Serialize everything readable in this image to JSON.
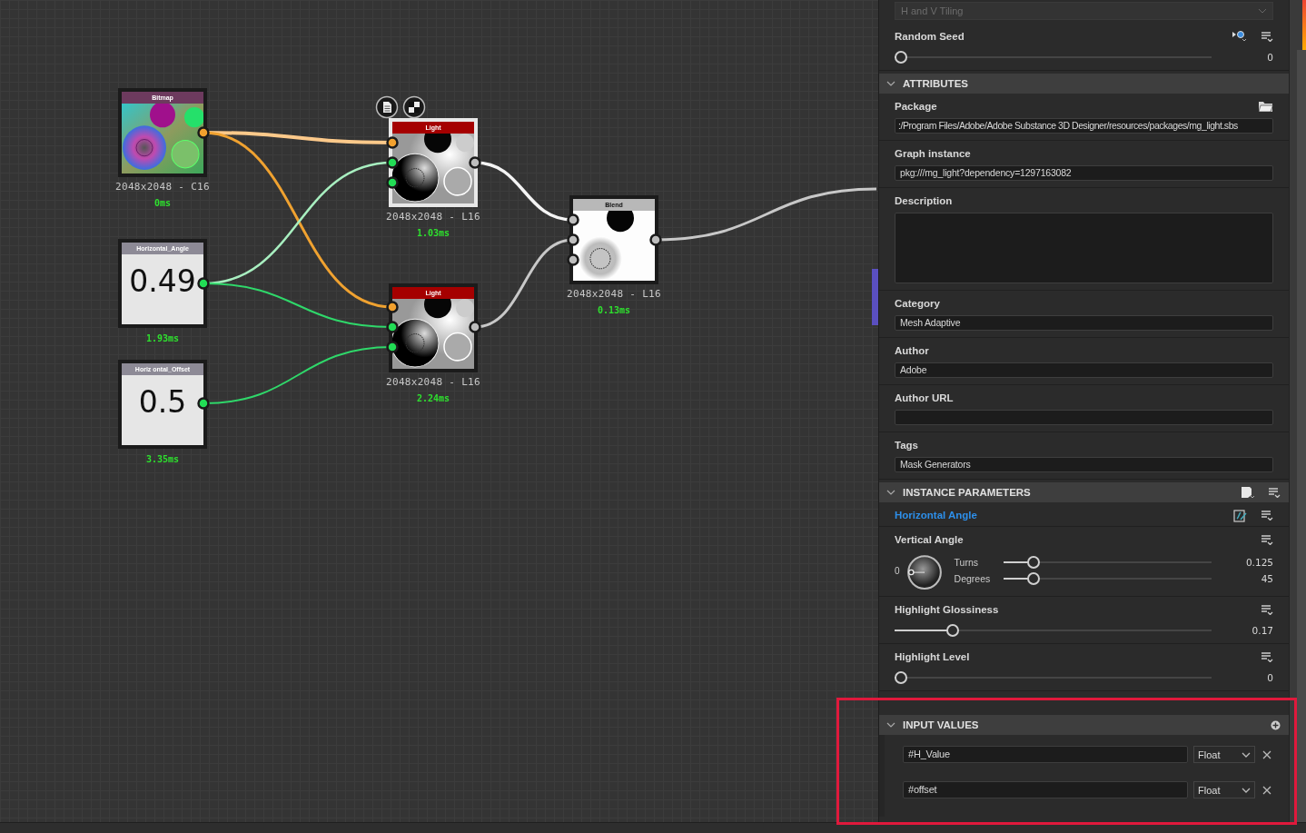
{
  "graph": {
    "nodes": [
      {
        "kind": "bitmap",
        "title": "Bitmap",
        "info": "2048x2048 - C16",
        "time": "0ms"
      },
      {
        "kind": "value",
        "title": "Horizontal_Angle",
        "value": "0.49",
        "time": "1.93ms"
      },
      {
        "kind": "value",
        "title": "Horiz ontal_Offset",
        "value": "0.5",
        "time": "3.35ms"
      },
      {
        "kind": "light",
        "title": "Light",
        "info": "2048x2048 - L16",
        "time": "1.03ms",
        "selected": true
      },
      {
        "kind": "light",
        "title": "Light",
        "info": "2048x2048 - L16",
        "time": "2.24ms",
        "selected": false
      },
      {
        "kind": "blend",
        "title": "Blend",
        "info": "2048x2048 - L16",
        "time": "0.13ms",
        "selected": false
      }
    ]
  },
  "panel": {
    "tiling_dropdown": {
      "value": "H and V Tiling",
      "disabled": true
    },
    "random_seed": {
      "label": "Random Seed",
      "level": 0,
      "reading": "0"
    },
    "attributes": {
      "title": "ATTRIBUTES",
      "expanded": true,
      "fields": [
        {
          "kind": "path",
          "label": "Package",
          "value": ":/Program Files/Adobe/Adobe Substance 3D Designer/resources/packages/mg_light.sbs"
        },
        {
          "kind": "line",
          "label": "Graph instance",
          "value": "pkg:///mg_light?dependency=1297163082"
        },
        {
          "kind": "area",
          "label": "Description"
        },
        {
          "kind": "line",
          "label": "Category",
          "value": "Mesh Adaptive"
        },
        {
          "kind": "line",
          "label": "Author",
          "value": "Adobe"
        },
        {
          "kind": "line",
          "label": "Author URL"
        },
        {
          "kind": "line",
          "label": "Tags",
          "value": "Mask Generators"
        }
      ]
    },
    "instance_parameters": {
      "title": "INSTANCE PARAMETERS",
      "expanded": true,
      "params": [
        {
          "kind": "link",
          "label": "Horizontal Angle"
        },
        {
          "kind": "angle",
          "label": "Vertical Angle",
          "dial_label": "0",
          "rows": [
            {
              "label": "Turns",
              "level": 0.125,
              "reading": "0.125"
            },
            {
              "label": "Degrees",
              "level": 0.125,
              "reading": "45"
            }
          ]
        },
        {
          "kind": "slider",
          "label": "Highlight Glossiness",
          "level": 0.17,
          "reading": "0.17"
        },
        {
          "kind": "slider",
          "label": "Highlight Level",
          "level": 0,
          "reading": "0"
        }
      ]
    },
    "input_values": {
      "title": "INPUT VALUES",
      "expanded": true,
      "items": [
        {
          "name": "#H_Value",
          "type": "Float"
        },
        {
          "name": "#offset",
          "type": "Float"
        }
      ]
    }
  }
}
